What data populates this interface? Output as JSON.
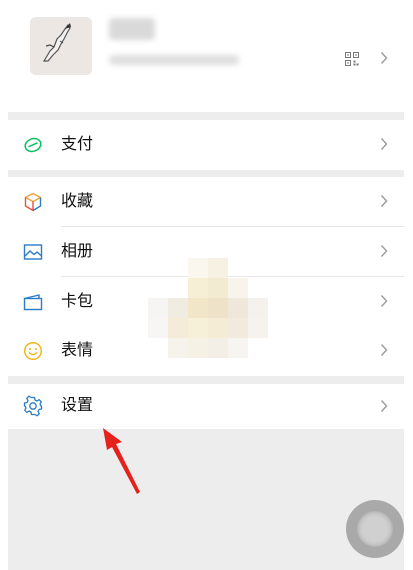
{
  "menu": {
    "pay_label": "支付",
    "favorites_label": "收藏",
    "album_label": "相册",
    "cards_label": "卡包",
    "stickers_label": "表情",
    "settings_label": "设置"
  },
  "colors": {
    "pay_icon": "#07c160",
    "favorites_icon": "#f0a33c",
    "album_icon": "#2a7cc7",
    "cards_icon": "#2a7cc7",
    "stickers_icon": "#f2b51e",
    "settings_icon": "#2a7cc7",
    "annotation_arrow": "#e5211b"
  },
  "icons": {
    "profile": [
      "qr-code-icon",
      "chevron-right-icon"
    ],
    "menu": [
      "wallet-icon",
      "cube-icon",
      "image-icon",
      "card-icon",
      "smiley-icon",
      "gear-icon"
    ]
  }
}
